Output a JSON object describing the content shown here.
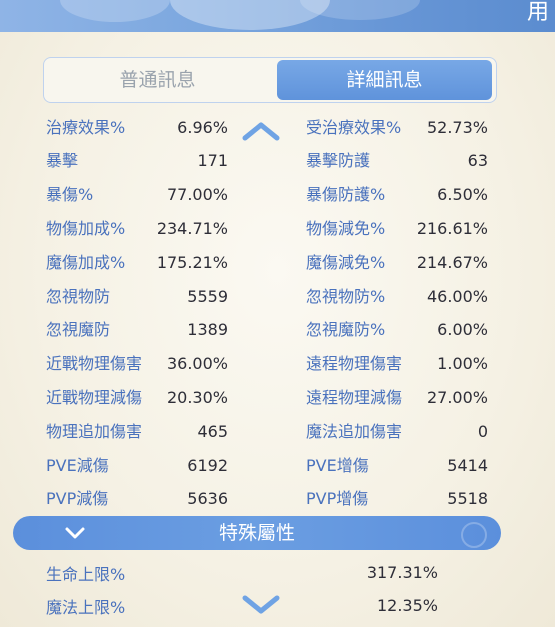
{
  "banner": {
    "text": "用"
  },
  "tabs": {
    "normal": "普通訊息",
    "detail": "詳細訊息"
  },
  "stats": [
    {
      "left_label": "治療效果%",
      "left_value": "6.96%",
      "right_label": "受治療效果%",
      "right_value": "52.73%"
    },
    {
      "left_label": "暴擊",
      "left_value": "171",
      "right_label": "暴擊防護",
      "right_value": "63"
    },
    {
      "left_label": "暴傷%",
      "left_value": "77.00%",
      "right_label": "暴傷防護%",
      "right_value": "6.50%"
    },
    {
      "left_label": "物傷加成%",
      "left_value": "234.71%",
      "right_label": "物傷減免%",
      "right_value": "216.61%"
    },
    {
      "left_label": "魔傷加成%",
      "left_value": "175.21%",
      "right_label": "魔傷減免%",
      "right_value": "214.67%"
    },
    {
      "left_label": "忽視物防",
      "left_value": "5559",
      "right_label": "忽視物防%",
      "right_value": "46.00%"
    },
    {
      "left_label": "忽視魔防",
      "left_value": "1389",
      "right_label": "忽視魔防%",
      "right_value": "6.00%"
    },
    {
      "left_label": "近戰物理傷害",
      "left_value": "36.00%",
      "right_label": "遠程物理傷害",
      "right_value": "1.00%"
    },
    {
      "left_label": "近戰物理減傷",
      "left_value": "20.30%",
      "right_label": "遠程物理減傷",
      "right_value": "27.00%"
    },
    {
      "left_label": "物理追加傷害",
      "left_value": "465",
      "right_label": "魔法追加傷害",
      "right_value": "0"
    },
    {
      "left_label": "PVE減傷",
      "left_value": "6192",
      "right_label": "PVE增傷",
      "right_value": "5414"
    },
    {
      "left_label": "PVP減傷",
      "left_value": "5636",
      "right_label": "PVP增傷",
      "right_value": "5518"
    }
  ],
  "special": {
    "title": "特殊屬性",
    "rows": [
      {
        "label": "生命上限%",
        "value": "317.31%"
      },
      {
        "label": "魔法上限%",
        "value": "12.35%"
      }
    ]
  },
  "icons": {
    "scroll_up": "chevron-up-icon",
    "scroll_down": "chevron-down-icon",
    "section_toggle": "chevron-down-icon"
  },
  "colors": {
    "accent": "#5f93db",
    "label": "#4a72bd",
    "value": "#2e2e38"
  }
}
